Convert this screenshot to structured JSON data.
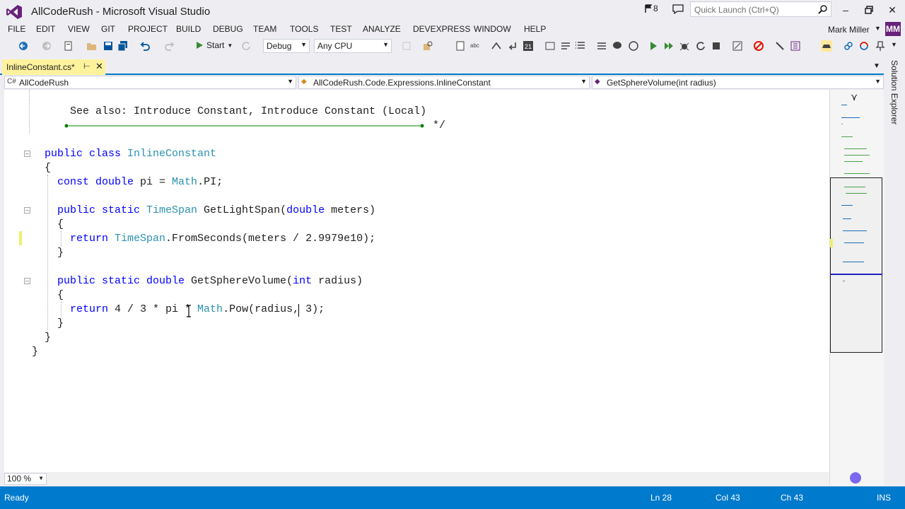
{
  "window": {
    "title": "AllCodeRush - Microsoft Visual Studio",
    "notification_count": "8",
    "quick_launch_placeholder": "Quick Launch (Ctrl+Q)"
  },
  "menu": {
    "items": [
      "FILE",
      "EDIT",
      "VIEW",
      "GIT",
      "PROJECT",
      "BUILD",
      "DEBUG",
      "TEAM",
      "TOOLS",
      "TEST",
      "ANALYZE",
      "DEVEXPRESS",
      "WINDOW",
      "HELP"
    ],
    "user_name": "Mark Miller",
    "user_initials": "MM"
  },
  "toolbar": {
    "start_label": "Start",
    "configuration": "Debug",
    "platform": "Any CPU"
  },
  "document_tab": {
    "label": "InlineConstant.cs*"
  },
  "navigation": {
    "project": "AllCodeRush",
    "type": "AllCodeRush.Code.Expressions.InlineConstant",
    "member": "GetSphereVolume(int radius)"
  },
  "code": {
    "see_also_line": "See also: Introduce Constant, Introduce Constant (Local)",
    "comment_end": "*/",
    "line_class": [
      "public class ",
      "InlineConstant"
    ],
    "brace_open": "{",
    "brace_close": "}",
    "line_const": [
      "const double",
      " pi = ",
      "Math",
      ".PI;"
    ],
    "line_getlightspan": [
      "public static ",
      "TimeSpan",
      " GetLightSpan(",
      "double",
      " meters)"
    ],
    "line_return1": [
      "return ",
      "TimeSpan",
      ".FromSeconds(meters / 2.9979e10);"
    ],
    "line_getsphere": [
      "public static double",
      " GetSphereVolume(",
      "int",
      " radius)"
    ],
    "line_return2": [
      "return",
      " 4 / 3 * pi * ",
      "Math",
      ".Pow(radius, 3);"
    ]
  },
  "editor": {
    "zoom": "100 %"
  },
  "side_tabs": {
    "solution_explorer": "Solution Explorer"
  },
  "status": {
    "state": "Ready",
    "line": "Ln 28",
    "col": "Col 43",
    "ch": "Ch 43",
    "mode": "INS"
  }
}
